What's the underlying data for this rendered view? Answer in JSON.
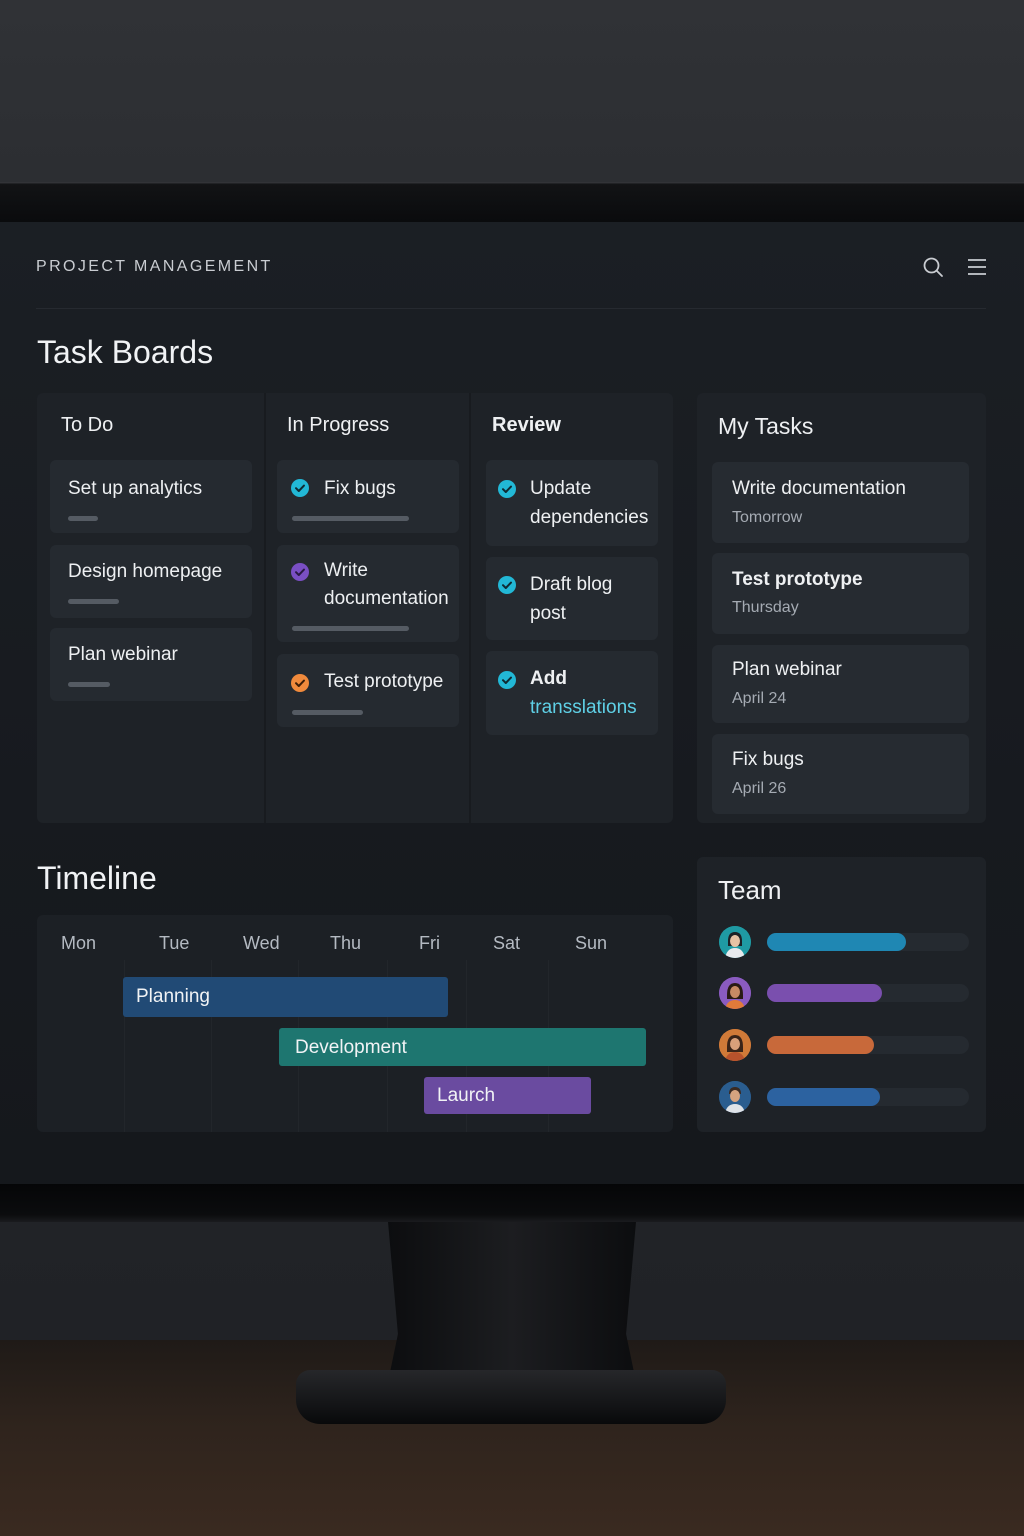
{
  "app": {
    "title": "PROJECT MANAGEMENT"
  },
  "header": {
    "icons": [
      "search-icon",
      "menu-icon"
    ]
  },
  "task_boards": {
    "title": "Task Boards",
    "columns": [
      {
        "title": "To Do",
        "cards": [
          {
            "title": "Set up analytics"
          },
          {
            "title": "Design homepage"
          },
          {
            "title": "Plan webinar"
          }
        ]
      },
      {
        "title": "In Progress",
        "cards": [
          {
            "title": "Fix bugs",
            "status_color": "#22b8d6"
          },
          {
            "title": "Write documentation",
            "title_line1": "Write",
            "title_line2": "documentation",
            "status_color": "#7a4fc4"
          },
          {
            "title": "Test prototype",
            "status_color": "#f08a3c"
          }
        ]
      },
      {
        "title": "Review",
        "cards": [
          {
            "title": "Update dependencies",
            "title_line1": "Update",
            "title_line2": "dependencies",
            "status_color": "#22b8d6"
          },
          {
            "title": "Draft blog post",
            "title_line1": "Draft blog",
            "title_line2": "post",
            "status_color": "#22b8d6"
          },
          {
            "title": "Add transslations",
            "title_line1": "Add",
            "title_line2": "transslations",
            "status_color": "#22b8d6"
          }
        ]
      }
    ]
  },
  "my_tasks": {
    "title": "My Tasks",
    "items": [
      {
        "title": "Write documentation",
        "due": "Tomorrow"
      },
      {
        "title": "Test prototype",
        "due": "Thursday"
      },
      {
        "title": "Plan webinar",
        "due": "April 24"
      },
      {
        "title": "Fix bugs",
        "due": "April 26"
      }
    ]
  },
  "timeline": {
    "title": "Timeline",
    "days": [
      "Mon",
      "Tue",
      "Wed",
      "Thu",
      "Fri",
      "Sat",
      "Sun"
    ],
    "bars": [
      {
        "label": "Planning",
        "color": "#214a75"
      },
      {
        "label": "Development",
        "color": "#1e7670"
      },
      {
        "label": "Laurch",
        "color": "#6a4ba0"
      }
    ]
  },
  "team": {
    "title": "Team",
    "members": [
      {
        "progress": 0.69,
        "color": "#1f87b3"
      },
      {
        "progress": 0.57,
        "color": "#7a4fae"
      },
      {
        "progress": 0.53,
        "color": "#c8693a"
      },
      {
        "progress": 0.56,
        "color": "#2c62a0"
      }
    ]
  }
}
